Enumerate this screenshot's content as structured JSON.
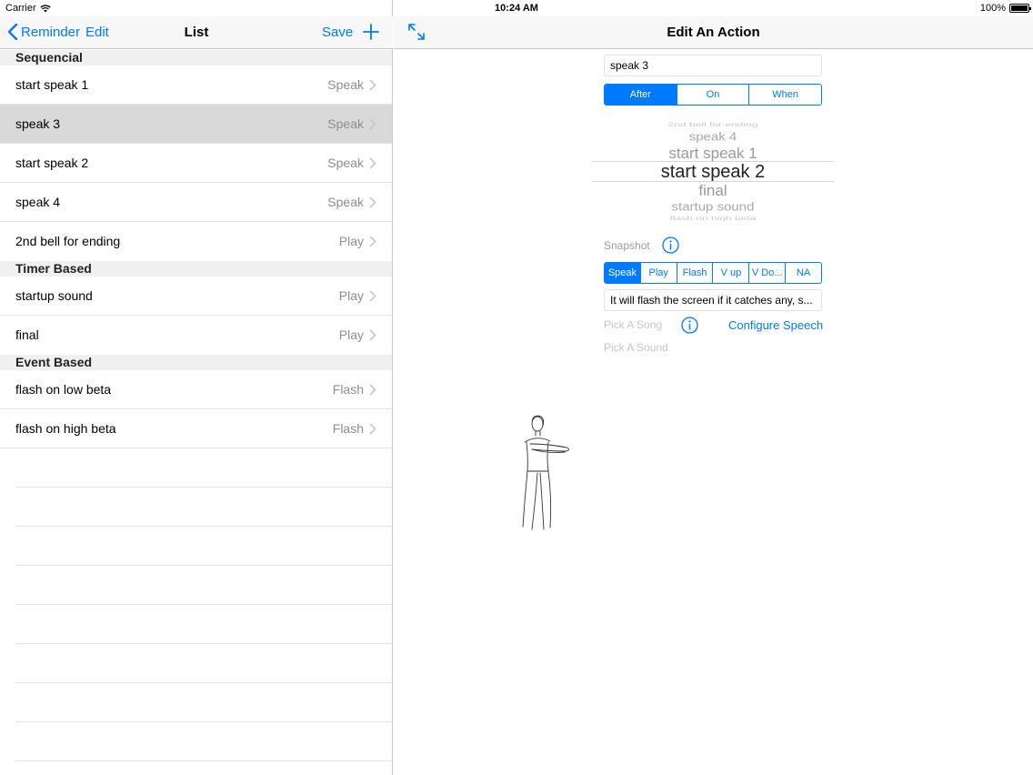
{
  "status_bar": {
    "carrier": "Carrier",
    "time": "10:24 AM",
    "battery": "100%"
  },
  "left_nav": {
    "back_label": "Reminder",
    "edit_label": "Edit",
    "title": "List",
    "save_label": "Save"
  },
  "sections": [
    {
      "title": "Sequencial",
      "rows": [
        {
          "name": "start speak 1",
          "type": "Speak"
        },
        {
          "name": "speak 3",
          "type": "Speak",
          "selected": true
        },
        {
          "name": "start speak 2",
          "type": "Speak"
        },
        {
          "name": "speak 4",
          "type": "Speak"
        },
        {
          "name": "2nd bell for ending",
          "type": "Play"
        }
      ]
    },
    {
      "title": "Timer Based",
      "rows": [
        {
          "name": "startup sound",
          "type": "Play"
        },
        {
          "name": "final",
          "type": "Play"
        }
      ]
    },
    {
      "title": "Event Based",
      "rows": [
        {
          "name": "flash on low beta",
          "type": "Flash"
        },
        {
          "name": "flash on high beta",
          "type": "Flash"
        }
      ]
    }
  ],
  "right_nav": {
    "title": "Edit An Action"
  },
  "form": {
    "name_value": "speak 3",
    "timing_options": [
      "After",
      "On",
      "When"
    ],
    "timing_selected": "After",
    "picker_items": [
      "2nd bell for ending",
      "speak 4",
      "start speak 1",
      "start speak 2",
      "final",
      "startup sound",
      "flash on high beta"
    ],
    "picker_selected": "start speak 2",
    "snapshot_label": "Snapshot",
    "action_options": [
      "Speak",
      "Play",
      "Flash",
      "V up",
      "V Do...",
      "NA"
    ],
    "action_selected": "Speak",
    "description": "It will flash the screen if it catches any, s...",
    "pick_song_label": "Pick A Song",
    "configure_label": "Configure Speech",
    "pick_sound_label": "Pick A Sound"
  },
  "colors": {
    "accent": "#007aff",
    "selected_row": "#d9d9d9",
    "section_bg": "#f0f0f3",
    "muted": "#8e8e93"
  },
  "icons": {
    "back": "chevron-left-icon",
    "add": "plus-icon",
    "expand": "expand-icon",
    "info": "info-icon",
    "wifi": "wifi-icon",
    "figure": "standing-figure-illustration"
  }
}
